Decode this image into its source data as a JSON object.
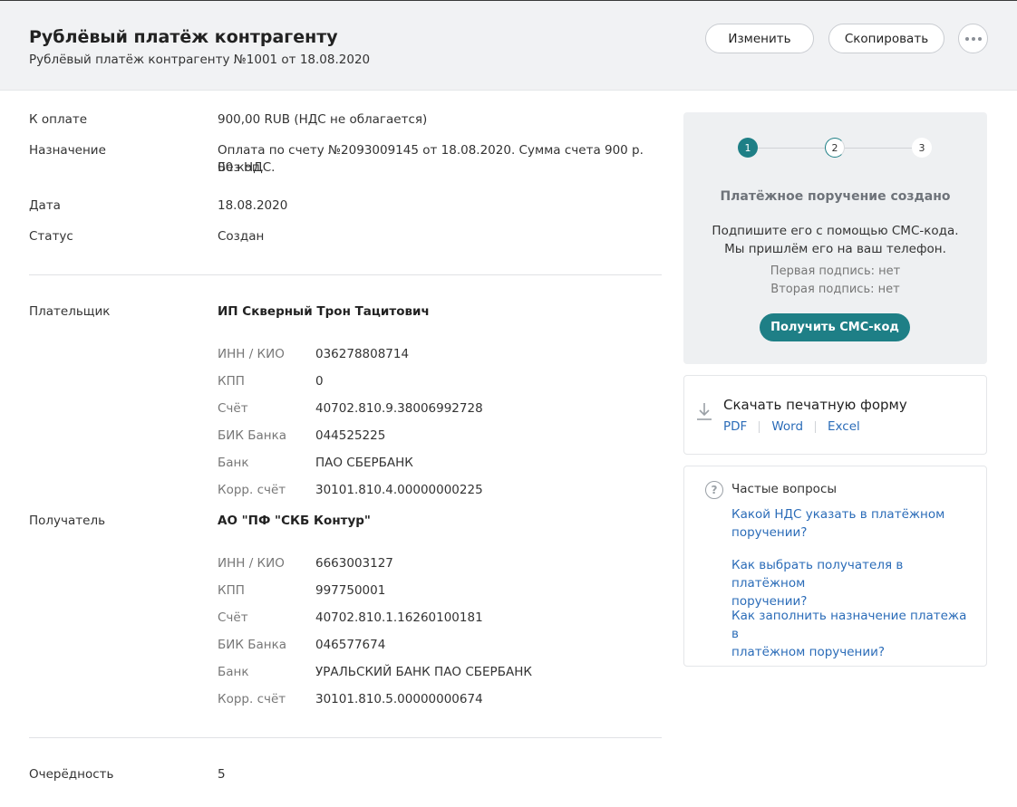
{
  "header": {
    "title": "Рублёвый платёж контрагенту",
    "subtitle": "Рублёвый платёж контрагенту №1001 от 18.08.2020",
    "edit_label": "Изменить",
    "copy_label": "Скопировать",
    "more_icon": "more-horizontal-icon"
  },
  "payment": {
    "amount_label": "К оплате",
    "amount_value": "900,00 RUB (НДС не облагается)",
    "purpose_label": "Назначение",
    "purpose_line1": "Оплата по счету №2093009145 от 18.08.2020. Сумма счета 900 р. 00 коп.",
    "purpose_line2": "Без НДС.",
    "date_label": "Дата",
    "date_value": "18.08.2020",
    "status_label": "Статус",
    "status_value": "Создан"
  },
  "payer": {
    "label": "Плательщик",
    "name": "ИП Скверный Трон Тацитович",
    "fields": [
      {
        "label": "ИНН / КИО",
        "value": "036278808714"
      },
      {
        "label": "КПП",
        "value": "0"
      },
      {
        "label": "Счёт",
        "value": "40702.810.9.38006992728"
      },
      {
        "label": "БИК Банка",
        "value": "044525225"
      },
      {
        "label": "Банк",
        "value": "ПАО СБЕРБАНК"
      },
      {
        "label": "Корр. счёт",
        "value": "30101.810.4.00000000225"
      }
    ]
  },
  "recipient": {
    "label": "Получатель",
    "name": "АО \"ПФ \"СКБ Контур\"",
    "fields": [
      {
        "label": "ИНН / КИО",
        "value": "6663003127"
      },
      {
        "label": "КПП",
        "value": "997750001"
      },
      {
        "label": "Счёт",
        "value": "40702.810.1.16260100181"
      },
      {
        "label": "БИК Банка",
        "value": "046577674"
      },
      {
        "label": "Банк",
        "value": "УРАЛЬСКИЙ БАНК ПАО СБЕРБАНК"
      },
      {
        "label": "Корр. счёт",
        "value": "30101.810.5.00000000674"
      }
    ]
  },
  "priority": {
    "label": "Очерёдность",
    "value": "5"
  },
  "status_card": {
    "steps": [
      "1",
      "2",
      "3"
    ],
    "title": "Платёжное поручение создано",
    "text_line1": "Подпишите его с помощью СМС-кода.",
    "text_line2": "Мы пришлём его на ваш телефон.",
    "first_sign": "Первая подпись: нет",
    "second_sign": "Вторая подпись: нет",
    "sms_button": "Получить СМС-код",
    "accent_color": "#1e7f86"
  },
  "download": {
    "icon": "download-icon",
    "title": "Скачать печатную форму",
    "pdf": "PDF",
    "word": "Word",
    "excel": "Excel"
  },
  "faq": {
    "icon": "question-circle-icon",
    "icon_glyph": "?",
    "title": "Частые вопросы",
    "links": [
      {
        "line1": "Какой НДС указать в платёжном",
        "line2": "поручении?"
      },
      {
        "line1": "Как выбрать получателя в платёжном",
        "line2": "поручении?"
      },
      {
        "line1": "Как заполнить назначение платежа в",
        "line2": "платёжном поручении?"
      }
    ],
    "link_color": "#2b6cb8"
  }
}
